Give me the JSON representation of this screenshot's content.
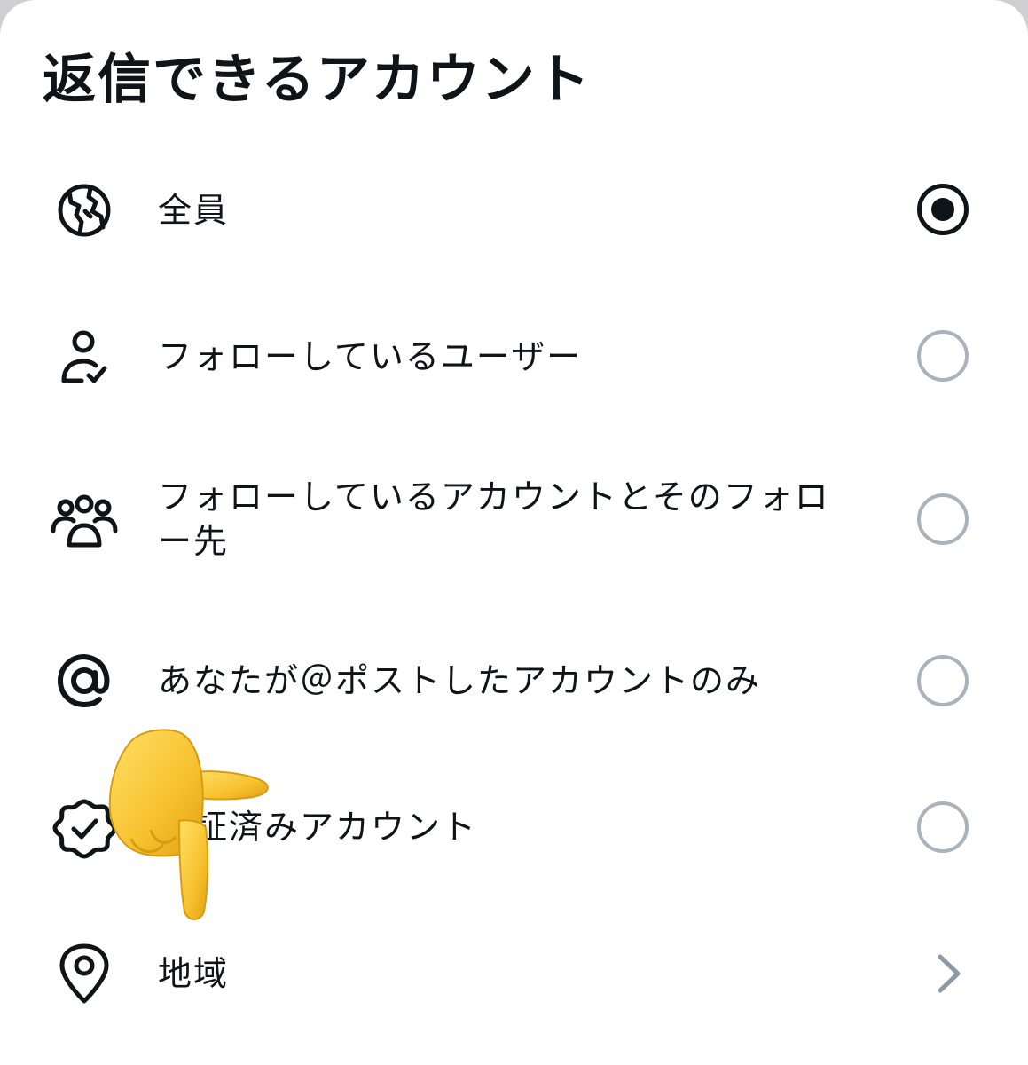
{
  "sheet": {
    "title": "返信できるアカウント"
  },
  "options": [
    {
      "label": "全員",
      "icon": "globe-icon",
      "control": "radio",
      "selected": true
    },
    {
      "label": "フォローしているユーザー",
      "icon": "person-check-icon",
      "control": "radio",
      "selected": false
    },
    {
      "label": "フォローしているアカウントとそのフォロー先",
      "icon": "group-icon",
      "control": "radio",
      "selected": false
    },
    {
      "label": "あなたが＠ポストしたアカウントのみ",
      "icon": "at-sign-icon",
      "control": "radio",
      "selected": false
    },
    {
      "label": "認証済みアカウント",
      "icon": "verified-badge-icon",
      "control": "radio",
      "selected": false
    },
    {
      "label": "地域",
      "icon": "location-pin-icon",
      "control": "chevron",
      "selected": false
    }
  ],
  "overlay": {
    "icon": "pointing-down-hand-emoji"
  },
  "colors": {
    "text": "#0f1419",
    "radio_unselected": "#aab3bb",
    "chevron": "#8b98a5",
    "hand": "#f7c12e"
  }
}
